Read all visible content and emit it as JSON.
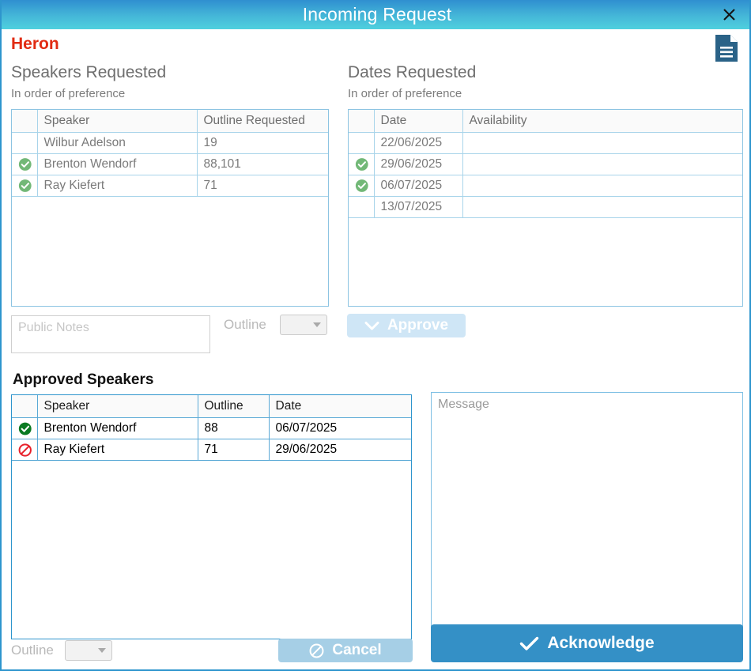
{
  "window": {
    "title": "Incoming Request",
    "close_icon": "close-icon",
    "document_icon": "document-icon"
  },
  "header": {
    "org_name": "Heron"
  },
  "speakers_requested": {
    "heading": "Speakers Requested",
    "subheading": "In order of preference",
    "columns": [
      "",
      "Speaker",
      "Outline Requested"
    ],
    "rows": [
      {
        "selected": false,
        "speaker": "Wilbur Adelson",
        "outline": "19"
      },
      {
        "selected": true,
        "speaker": "Brenton Wendorf",
        "outline": "88,101"
      },
      {
        "selected": true,
        "speaker": "Ray Kiefert",
        "outline": "71"
      }
    ]
  },
  "dates_requested": {
    "heading": "Dates Requested",
    "subheading": "In order of preference",
    "columns": [
      "",
      "Date",
      "Availability"
    ],
    "rows": [
      {
        "selected": false,
        "date": "22/06/2025",
        "availability": ""
      },
      {
        "selected": true,
        "date": "29/06/2025",
        "availability": ""
      },
      {
        "selected": true,
        "date": "06/07/2025",
        "availability": ""
      },
      {
        "selected": false,
        "date": "13/07/2025",
        "availability": ""
      }
    ]
  },
  "middle_controls": {
    "public_notes_placeholder": "Public Notes",
    "outline_label": "Outline",
    "outline_value": "",
    "approve_label": "Approve",
    "approve_icon": "chevron-down-icon",
    "approve_enabled": false
  },
  "approved_speakers": {
    "heading": "Approved Speakers",
    "columns": [
      "",
      "Speaker",
      "Outline",
      "Date"
    ],
    "rows": [
      {
        "status": "approved",
        "speaker": "Brenton Wendorf",
        "outline": "88",
        "date": "06/07/2025"
      },
      {
        "status": "blocked",
        "speaker": "Ray Kiefert",
        "outline": "71",
        "date": "29/06/2025"
      }
    ]
  },
  "bottom_controls": {
    "outline_label": "Outline",
    "outline_value": "",
    "cancel_label": "Cancel",
    "cancel_icon": "no-entry-icon",
    "cancel_enabled": false
  },
  "message_panel": {
    "placeholder": "Message",
    "value": "",
    "acknowledge_label": "Acknowledge",
    "acknowledge_icon": "check-icon",
    "acknowledge_enabled": true
  },
  "colors": {
    "titlebar_start": "#2f8fd0",
    "titlebar_end": "#4fd0de",
    "org_red": "#e12b12",
    "accent_blue": "#2e95cd",
    "ack_blue": "#3490c6",
    "check_green_light": "#72b877",
    "check_green_dark": "#0a7a22",
    "block_red": "#e8202a",
    "doc_icon_blue": "#2a6287"
  }
}
